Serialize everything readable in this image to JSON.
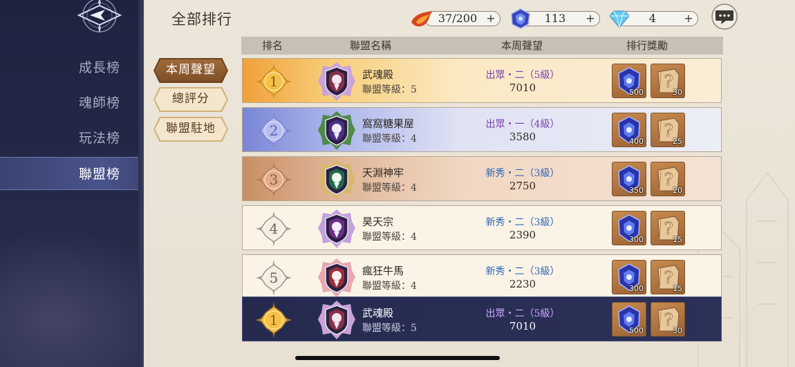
{
  "page_title": "全部排行",
  "resources": [
    {
      "name": "stamina",
      "icon": "flame-icon",
      "value": "37/200"
    },
    {
      "name": "soul-crystal",
      "icon": "blue-crystal-icon",
      "value": "113"
    },
    {
      "name": "diamond",
      "icon": "diamond-icon",
      "value": "4"
    }
  ],
  "sidebar": {
    "items": [
      {
        "label": "成長榜",
        "active": false
      },
      {
        "label": "魂師榜",
        "active": false
      },
      {
        "label": "玩法榜",
        "active": false
      },
      {
        "label": "聯盟榜",
        "active": true
      }
    ]
  },
  "tabs": [
    {
      "label": "本周聲望",
      "active": true
    },
    {
      "label": "總評分",
      "active": false
    },
    {
      "label": "聯盟駐地",
      "active": false
    }
  ],
  "table": {
    "headers": [
      "排名",
      "聯盟名稱",
      "本周聲望",
      "排行獎勵"
    ],
    "rows": [
      {
        "rank": "1",
        "name": "武魂殿",
        "level": "聯盟等級：5",
        "tier": "出眾・二（5級）",
        "fame": "7010",
        "reward_crystal": "500",
        "reward_chest": "30"
      },
      {
        "rank": "2",
        "name": "窩窩糖果屋",
        "level": "聯盟等級：4",
        "tier": "出眾・一（4級）",
        "fame": "3580",
        "reward_crystal": "400",
        "reward_chest": "25"
      },
      {
        "rank": "3",
        "name": "天淵神牢",
        "level": "聯盟等級：4",
        "tier": "新秀・二（3級）",
        "fame": "2750",
        "reward_crystal": "350",
        "reward_chest": "20"
      },
      {
        "rank": "4",
        "name": "昊天宗",
        "level": "聯盟等級：4",
        "tier": "新秀・二（3級）",
        "fame": "2390",
        "reward_crystal": "300",
        "reward_chest": "15"
      },
      {
        "rank": "5",
        "name": "瘋狂牛馬",
        "level": "聯盟等級：4",
        "tier": "新秀・二（3級）",
        "fame": "2230",
        "reward_crystal": "300",
        "reward_chest": "15"
      }
    ],
    "self_row": {
      "rank": "1",
      "name": "武魂殿",
      "level": "聯盟等級：5",
      "tier": "出眾・二（5級）",
      "fame": "7010",
      "reward_crystal": "500",
      "reward_chest": "30"
    }
  },
  "colors": {
    "tier_elite": "#7a3fb0",
    "tier_rookie": "#2f63b5",
    "gold": "#e8b640",
    "sidebar_bg": "#1e2340",
    "tab_active": "#8b5a2e"
  }
}
